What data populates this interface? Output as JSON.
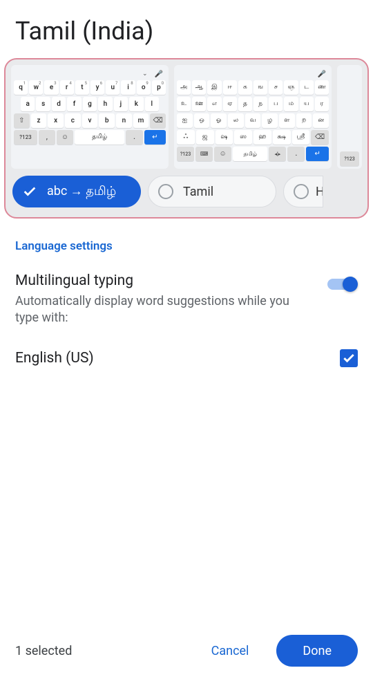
{
  "title": "Tamil (India)",
  "previews": {
    "qwerty": {
      "row1": [
        {
          "k": "q",
          "s": "1"
        },
        {
          "k": "w",
          "s": "2"
        },
        {
          "k": "e",
          "s": "3"
        },
        {
          "k": "r",
          "s": "4"
        },
        {
          "k": "t",
          "s": "5"
        },
        {
          "k": "y",
          "s": "6"
        },
        {
          "k": "u",
          "s": "7"
        },
        {
          "k": "i",
          "s": "8"
        },
        {
          "k": "o",
          "s": "9"
        },
        {
          "k": "p",
          "s": "0"
        }
      ],
      "row2": [
        "a",
        "s",
        "d",
        "f",
        "g",
        "h",
        "j",
        "k",
        "l"
      ],
      "row3": [
        "z",
        "x",
        "c",
        "v",
        "b",
        "n",
        "m"
      ],
      "shift": "⇧",
      "backspace": "⌫",
      "num": "?123",
      "comma": ",",
      "emoji": "☺",
      "space": "தமிழ்",
      "period": ".",
      "enter": "↵",
      "mic": "🎤",
      "chev": "⌄"
    },
    "tamil": {
      "row1": [
        "அ",
        "ஆ",
        "இ",
        "ஈ",
        "க",
        "ங",
        "ச",
        "ஞ",
        "ட",
        "ண"
      ],
      "row2": [
        "உ",
        "ஊ",
        "எ",
        "ஏ",
        "த",
        "ந",
        "ப",
        "ம",
        "ய",
        "ர"
      ],
      "row3": [
        "ஐ",
        "ஒ",
        "ஓ",
        "ல",
        "வ",
        "ழ",
        "ள",
        "ற",
        "ன"
      ],
      "row4": [
        "ஃ",
        "ஜ",
        "ஷ",
        "ஸ",
        "ஹ",
        "க்ஷ",
        "ஶ்ரீ"
      ],
      "backspace": "⌫",
      "num": "?123",
      "lang": "⌨",
      "emoji": "☺",
      "space": "தமிழ்",
      "cursor": "◂¦▸",
      "period": ".",
      "enter": "↵",
      "mic": "🎤"
    },
    "partial": {
      "num": "?123"
    }
  },
  "options": {
    "opt1": "abc → தமிழ்",
    "opt2": "Tamil",
    "opt3": "Ha"
  },
  "section_label": "Language settings",
  "multilingual": {
    "title": "Multilingual typing",
    "sub": "Automatically display word suggestions while you type with:",
    "enabled": true
  },
  "languages": {
    "english": "English (US)"
  },
  "footer": {
    "status": "1 selected",
    "cancel": "Cancel",
    "done": "Done"
  }
}
